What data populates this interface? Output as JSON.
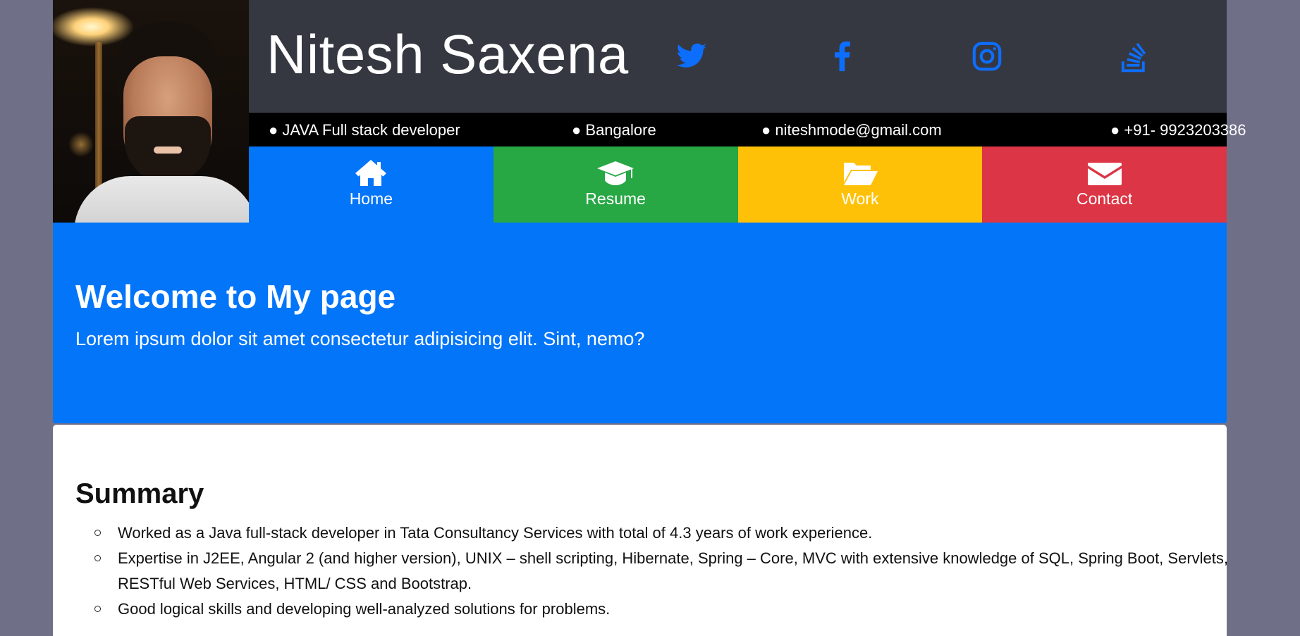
{
  "header": {
    "name": "Nitesh Saxena",
    "social": [
      {
        "icon": "twitter-icon"
      },
      {
        "icon": "facebook-icon"
      },
      {
        "icon": "instagram-icon"
      },
      {
        "icon": "stackoverflow-icon"
      }
    ],
    "social_color": "#0d6efd",
    "topbar_color": "#353841"
  },
  "info": {
    "role": "● JAVA Full stack developer",
    "location": "● Bangalore",
    "email": "● niteshmode@gmail.com",
    "phone": "● +91- 9923203386"
  },
  "nav": {
    "items": [
      {
        "label": "Home",
        "icon": "home-icon",
        "color": "#0275f9"
      },
      {
        "label": "Resume",
        "icon": "graduation-cap-icon",
        "color": "#28a745"
      },
      {
        "label": "Work",
        "icon": "folder-open-icon",
        "color": "#ffc107"
      },
      {
        "label": "Contact",
        "icon": "envelope-icon",
        "color": "#dc3545"
      }
    ]
  },
  "hero": {
    "title": "Welcome to My page",
    "subtitle": "Lorem ipsum dolor sit amet consectetur adipisicing elit. Sint, nemo?",
    "color": "#0275f9"
  },
  "summary": {
    "title": "Summary",
    "items": [
      "Worked as a Java full-stack developer in Tata Consultancy Services with total of 4.3 years of work experience.",
      "Expertise in J2EE, Angular 2 (and higher version), UNIX – shell scripting, Hibernate, Spring – Core, MVC with extensive knowledge of SQL, Spring Boot, Servlets, RESTful Web Services, HTML/ CSS and Bootstrap.",
      "Good logical skills and developing well-analyzed solutions for problems."
    ]
  }
}
